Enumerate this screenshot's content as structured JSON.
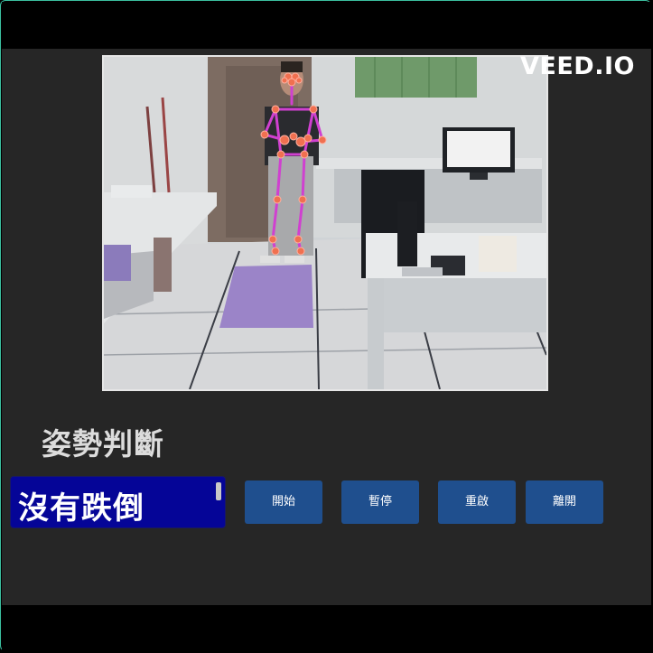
{
  "watermark": "VEED.IO",
  "section_title": "姿勢判斷",
  "status": {
    "text": "沒有跌倒"
  },
  "buttons": {
    "start": "開始",
    "pause": "暫停",
    "restart": "重啟",
    "exit": "離開"
  },
  "colors": {
    "app_background": "#262626",
    "status_box": "#050597",
    "button": "#1f4f8e",
    "skeleton_line": "#d040d0",
    "skeleton_joint": "#f07050"
  }
}
